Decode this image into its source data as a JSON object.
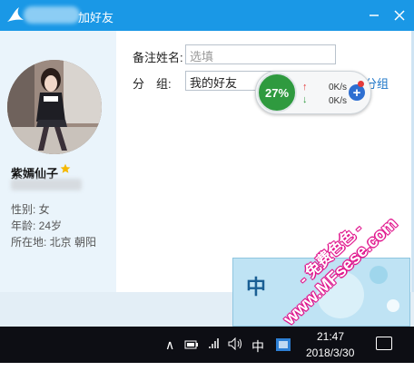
{
  "window": {
    "title_suffix": "加好友"
  },
  "profile": {
    "nickname": "紫嫣仙子",
    "gender_label": "性别: 女",
    "age_label": "年龄: 24岁",
    "location_label": "所在地: 北京  朝阳"
  },
  "form": {
    "remark_label": "备注姓名:",
    "remark_placeholder": "选填",
    "group_label": "分　组:",
    "group_value": "我的好友",
    "create_group_link": "新建分组"
  },
  "speed_widget": {
    "percent": "27%",
    "upload_speed": "0K/s",
    "download_speed": "0K/s",
    "up_arrow": "↑",
    "down_arrow": "↓",
    "plus": "+"
  },
  "ime": {
    "char": "中"
  },
  "watermark": {
    "line1": "- 免费色色 -",
    "line2": "www.MFsese.com"
  },
  "taskbar": {
    "tray_chevron": "∧",
    "ime_indicator": "中",
    "time": "21:47",
    "date": "2018/3/30"
  },
  "colors": {
    "titlebar": "#1a98e6",
    "accent_link": "#1b74c7",
    "gauge_green": "#2f9a3f",
    "watermark_pink": "#e0148c"
  }
}
